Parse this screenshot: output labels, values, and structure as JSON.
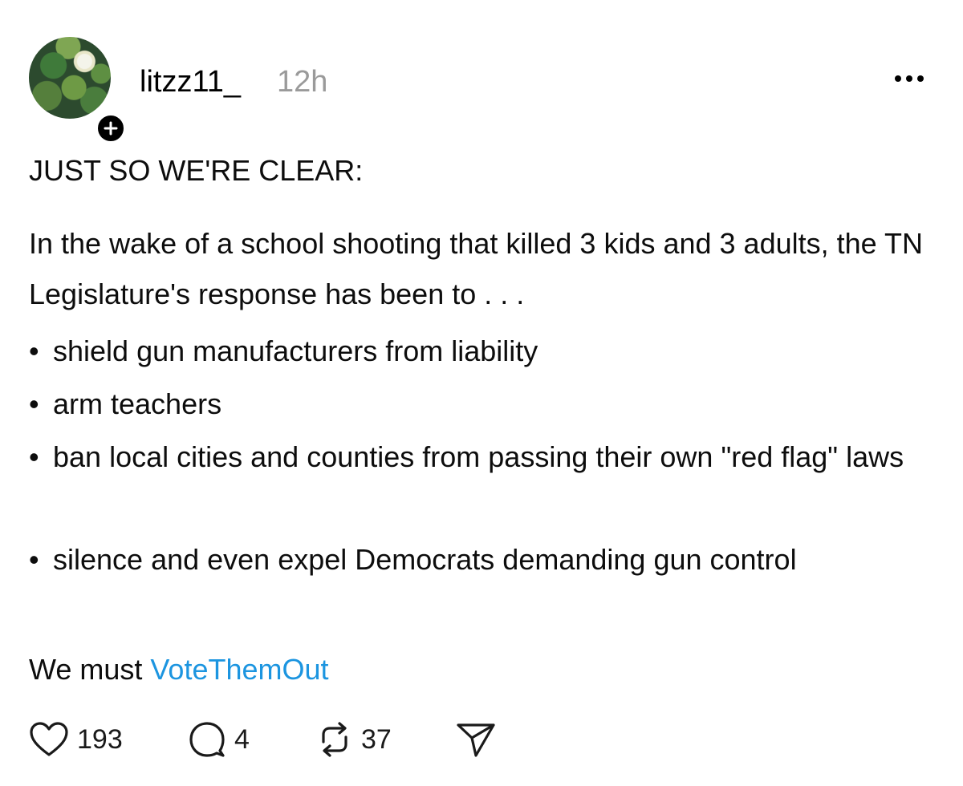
{
  "post": {
    "username": "litzz11_",
    "time": "12h",
    "headline": "JUST SO WE'RE CLEAR:",
    "intro": "In the wake of a school shooting that killed 3 kids and 3 adults, the TN Legislature's response has been to . . .",
    "bullets": [
      {
        "marker": "•",
        "text": "shield gun manufacturers from liability"
      },
      {
        "marker": "•",
        "text": "arm teachers"
      },
      {
        "marker": "•",
        "text": "ban local cities and counties from passing their own \"red flag\" laws"
      },
      {
        "marker": "•",
        "text": "silence and even expel Democrats demanding gun control"
      }
    ],
    "closing_prefix": "We must",
    "hashtag": "VoteThemOut"
  },
  "actions": {
    "likes": "193",
    "replies": "4",
    "reposts": "37"
  },
  "icons": {
    "avatar": "water-lily-avatar",
    "follow": "plus-icon",
    "more": "more-dots-icon",
    "like": "heart-icon",
    "reply": "comment-icon",
    "repost": "repost-icon",
    "share": "send-icon"
  },
  "colors": {
    "hashtag": "#1c95e0",
    "timestamp": "#9a9a9a",
    "text": "#0d0d0d"
  }
}
